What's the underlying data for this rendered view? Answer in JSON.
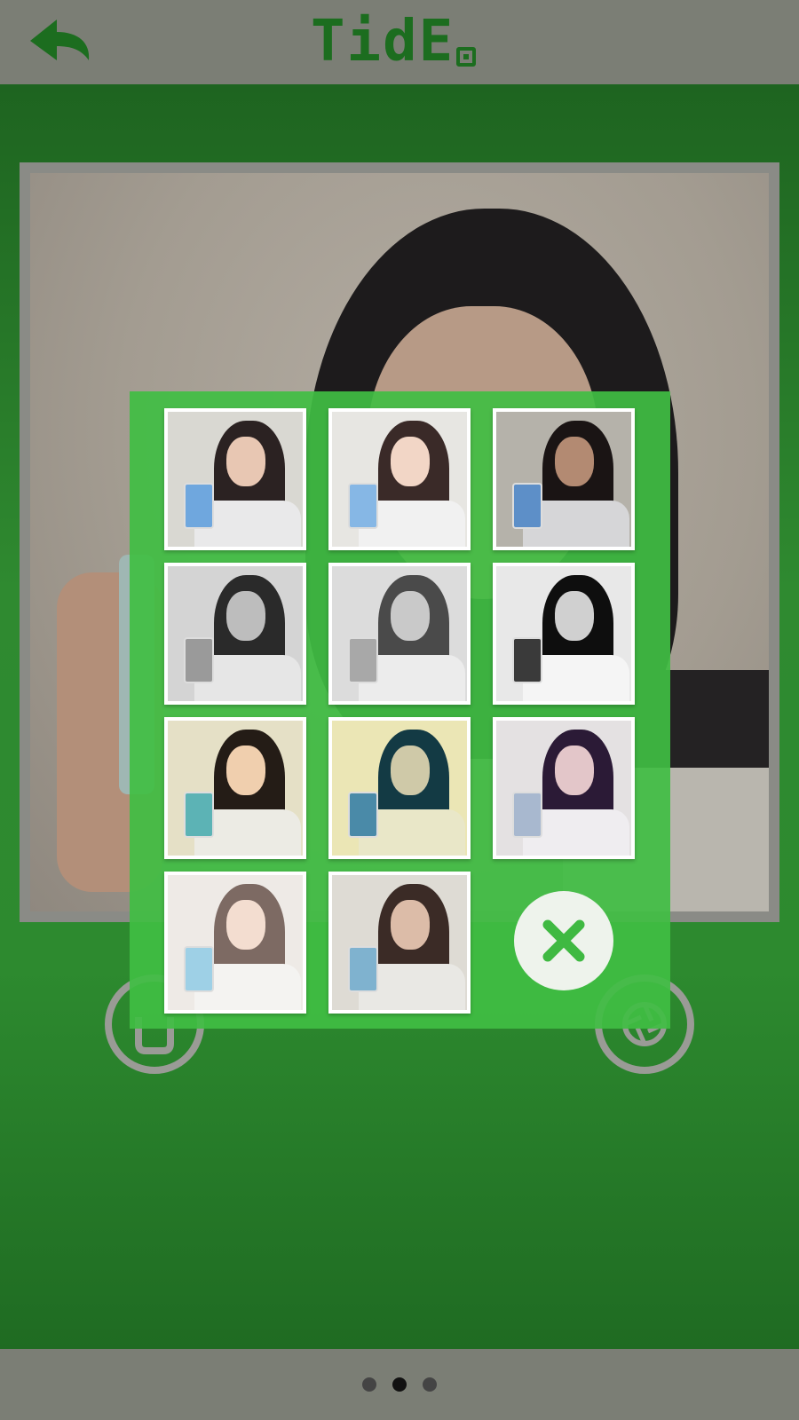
{
  "app": {
    "title": "TidEQ",
    "logo_text": "TidE",
    "brand_color": "#1c6d1f",
    "panel_color": "#40be43"
  },
  "header": {
    "back_icon": "back-arrow-icon"
  },
  "filters": [
    {
      "name": "filter-original"
    },
    {
      "name": "filter-bright"
    },
    {
      "name": "filter-dark"
    },
    {
      "name": "filter-grayscale"
    },
    {
      "name": "filter-light-gray"
    },
    {
      "name": "filter-high-contrast-bw"
    },
    {
      "name": "filter-warm"
    },
    {
      "name": "filter-cyan-cross"
    },
    {
      "name": "filter-purple"
    },
    {
      "name": "filter-faded"
    },
    {
      "name": "filter-vintage"
    }
  ],
  "controls": {
    "close_icon": "close-icon",
    "left_button_icon": "gallery-icon",
    "right_button_icon": "shutter-icon"
  },
  "pager": {
    "pages": 3,
    "active_index": 1
  }
}
